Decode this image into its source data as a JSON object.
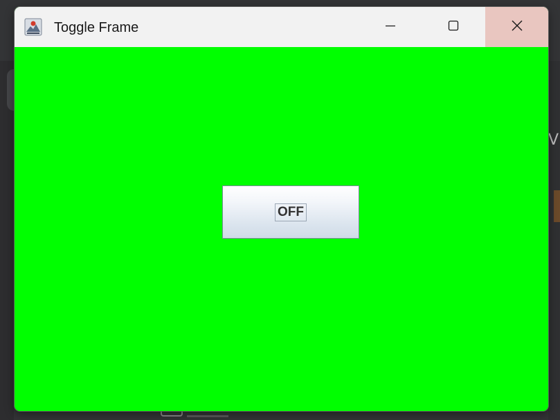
{
  "window": {
    "title": "Toggle Frame",
    "icon": "java-cup-icon",
    "controls": {
      "minimize": "minimize-icon",
      "maximize": "maximize-icon",
      "close": "close-icon"
    }
  },
  "content": {
    "background_color": "#00ff00",
    "toggle_button": {
      "label": "OFF"
    }
  }
}
